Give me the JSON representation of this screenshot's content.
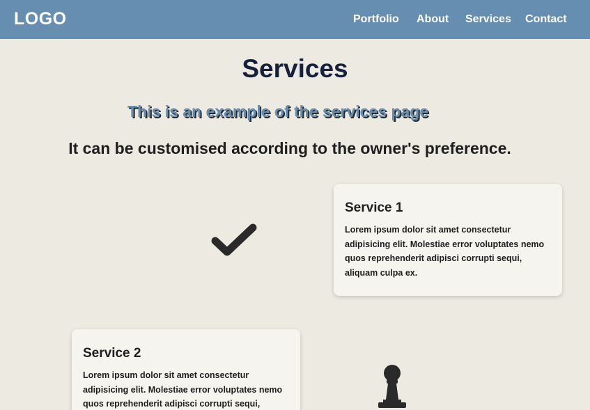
{
  "nav": {
    "logo": "LOGO",
    "links": [
      "Portfolio",
      "About",
      "Services",
      "Contact"
    ]
  },
  "page": {
    "title": "Services",
    "subtitle": "This is an example of the services page",
    "tagline": "It can be customised according to the owner's preference."
  },
  "services": [
    {
      "title": "Service 1",
      "body": "Lorem ipsum dolor sit amet consectetur adipisicing elit. Molestiae error voluptates nemo quos reprehenderit adipisci corrupti sequi, aliquam culpa ex.",
      "icon": "checkmark-icon"
    },
    {
      "title": "Service 2",
      "body": "Lorem ipsum dolor sit amet consectetur adipisicing elit. Molestiae error voluptates nemo quos reprehenderit adipisci corrupti sequi,",
      "icon": "chess-pawn-icon"
    }
  ],
  "colors": {
    "navbar": "#668eb0",
    "background": "#edebe1",
    "title": "#15203c",
    "card": "#f5f4ee"
  }
}
